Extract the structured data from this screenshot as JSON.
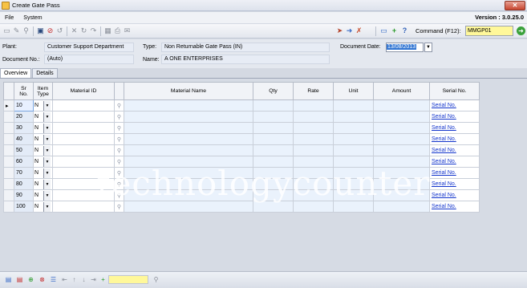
{
  "window": {
    "title": "Create Gate Pass",
    "close_glyph": "✕"
  },
  "menu": {
    "items": [
      "File",
      "System"
    ],
    "version": "Version : 3.0.25.0"
  },
  "toolbar": {
    "command_label": "Command (F12):",
    "command_value": "MMGP01",
    "go_icon": "go-arrow-icon"
  },
  "form": {
    "plant_label": "Plant:",
    "plant_value": "Customer Support Department",
    "type_label": "Type:",
    "type_value": "Non Returnable Gate Pass (IN)",
    "doc_no_label": "Document No.:",
    "doc_no_value": "(Auto)",
    "name_label": "Name:",
    "name_value": "A ONE ENTERPRISES",
    "doc_date_label": "Document Date:",
    "doc_date_value": "13/08/2013"
  },
  "tabs": [
    {
      "label": "Overview",
      "active": true
    },
    {
      "label": "Details",
      "active": false
    }
  ],
  "grid": {
    "columns": {
      "sr_no": "Sr\nNo.",
      "item_type": "Item\nType",
      "material_id": "Material ID",
      "material_name": "Material Name",
      "qty": "Qty",
      "rate": "Rate",
      "unit": "Unit",
      "amount": "Amount",
      "serial_no": "Serial No."
    },
    "rows": [
      {
        "sr": "10",
        "item_type": "N",
        "serial": "Serial No."
      },
      {
        "sr": "20",
        "item_type": "N",
        "serial": "Serial No."
      },
      {
        "sr": "30",
        "item_type": "N",
        "serial": "Serial No."
      },
      {
        "sr": "40",
        "item_type": "N",
        "serial": "Serial No."
      },
      {
        "sr": "50",
        "item_type": "N",
        "serial": "Serial No."
      },
      {
        "sr": "60",
        "item_type": "N",
        "serial": "Serial No."
      },
      {
        "sr": "70",
        "item_type": "N",
        "serial": "Serial No."
      },
      {
        "sr": "80",
        "item_type": "N",
        "serial": "Serial No."
      },
      {
        "sr": "90",
        "item_type": "N",
        "serial": "Serial No."
      },
      {
        "sr": "100",
        "item_type": "N",
        "serial": "Serial No."
      }
    ]
  },
  "watermark": "technologycounter",
  "colors": {
    "command_bg": "#fff89a",
    "link": "#1234cc",
    "date_highlight": "#3276d3"
  }
}
